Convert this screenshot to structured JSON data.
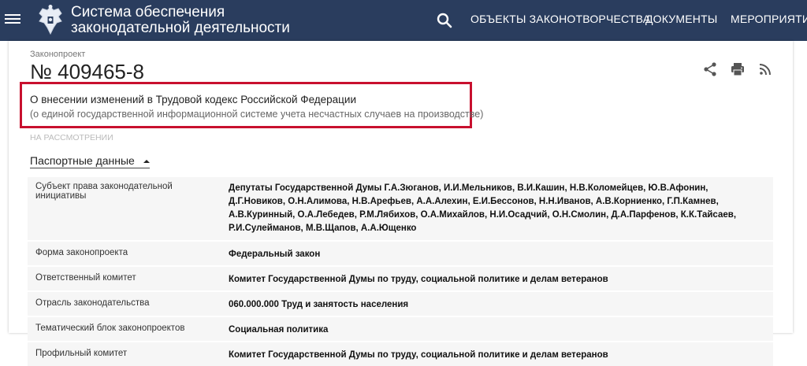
{
  "header": {
    "title_line1": "Система обеспечения",
    "title_line2": "законодательной деятельности",
    "nav": [
      {
        "label": "ОБЪЕКТЫ ЗАКОНОТВОРЧЕСТВА"
      },
      {
        "label": "ДОКУМЕНТЫ"
      },
      {
        "label": "МЕРОПРИЯТИЯ"
      }
    ]
  },
  "bill": {
    "type_label": "Законопроект",
    "number": "№ 409465-8",
    "title": "О внесении изменений в Трудовой кодекс Российской Федерации",
    "subtitle": "(о единой государственной информационной системе учета несчастных случаев на производстве)",
    "status": "НА РАССМОТРЕНИИ"
  },
  "passport": {
    "section_label": "Паспортные данные",
    "rows": [
      {
        "label": "Субъект права законодательной инициативы",
        "value": "Депутаты Государственной Думы Г.А.Зюганов, И.И.Мельников, В.И.Кашин, Н.В.Коломейцев, Ю.В.Афонин, Д.Г.Новиков, О.Н.Алимова, Н.В.Арефьев, А.А.Алехин, Е.И.Бессонов, Н.Н.Иванов, А.В.Корниенко, Г.П.Камнев, А.В.Куринный, О.А.Лебедев, Р.М.Лябихов, О.А.Михайлов, Н.И.Осадчий, О.Н.Смолин, Д.А.Парфенов, К.К.Тайсаев, Р.И.Сулейманов, М.В.Щапов, А.А.Ющенко"
      },
      {
        "label": "Форма законопроекта",
        "value": "Федеральный закон"
      },
      {
        "label": "Ответственный комитет",
        "value": "Комитет Государственной Думы по труду, социальной политике и делам ветеранов"
      },
      {
        "label": "Отрасль законодательства",
        "value": "060.000.000 Труд и занятость населения"
      },
      {
        "label": "Тематический блок законопроектов",
        "value": "Социальная политика"
      },
      {
        "label": "Профильный комитет",
        "value": "Комитет Государственной Думы по труду, социальной политике и делам ветеранов"
      }
    ]
  },
  "colors": {
    "header_bg": "#2a3d5e",
    "highlight_border": "#c8102e"
  },
  "icons": [
    "menu-icon",
    "emblem-icon",
    "search-icon",
    "share-icon",
    "print-icon",
    "rss-icon",
    "caret-up-icon"
  ]
}
